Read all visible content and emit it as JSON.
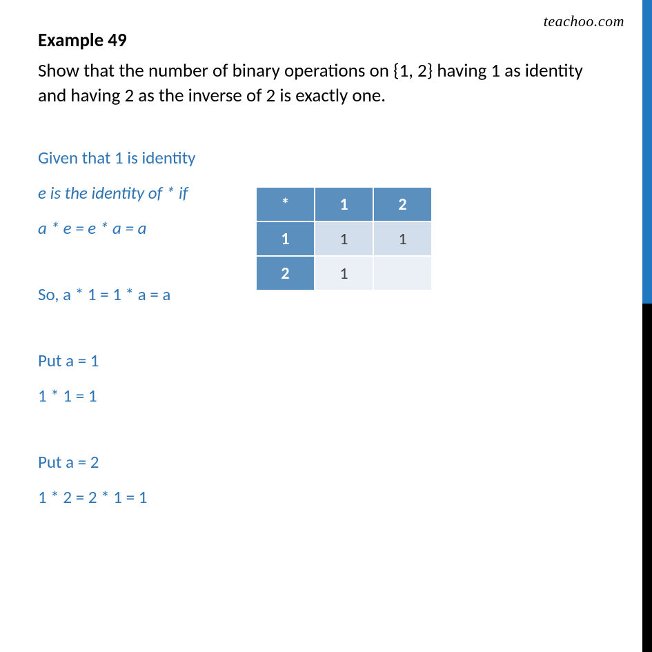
{
  "watermark": "teachoo.com",
  "title": "Example 49",
  "problem": "Show that the number of binary operations on {1, 2} having 1 as identity and having 2 as the inverse of 2 is exactly one.",
  "lines": {
    "given": "Given that 1 is identity",
    "def": "e is the identity of * if",
    "eq1": "a * e  = e * a = a",
    "so": "So, a * 1 = 1 * a = a",
    "put1": "Put a = 1",
    "r1": "1 * 1 = 1",
    "put2": "Put a = 2",
    "r2": "1 * 2 = 2 * 1 = 1"
  },
  "table": {
    "h00": "*",
    "h01": "1",
    "h02": "2",
    "r1c0": "1",
    "r1c1": "1",
    "r1c2": "1",
    "r2c0": "2",
    "r2c1": "1",
    "r2c2": ""
  }
}
